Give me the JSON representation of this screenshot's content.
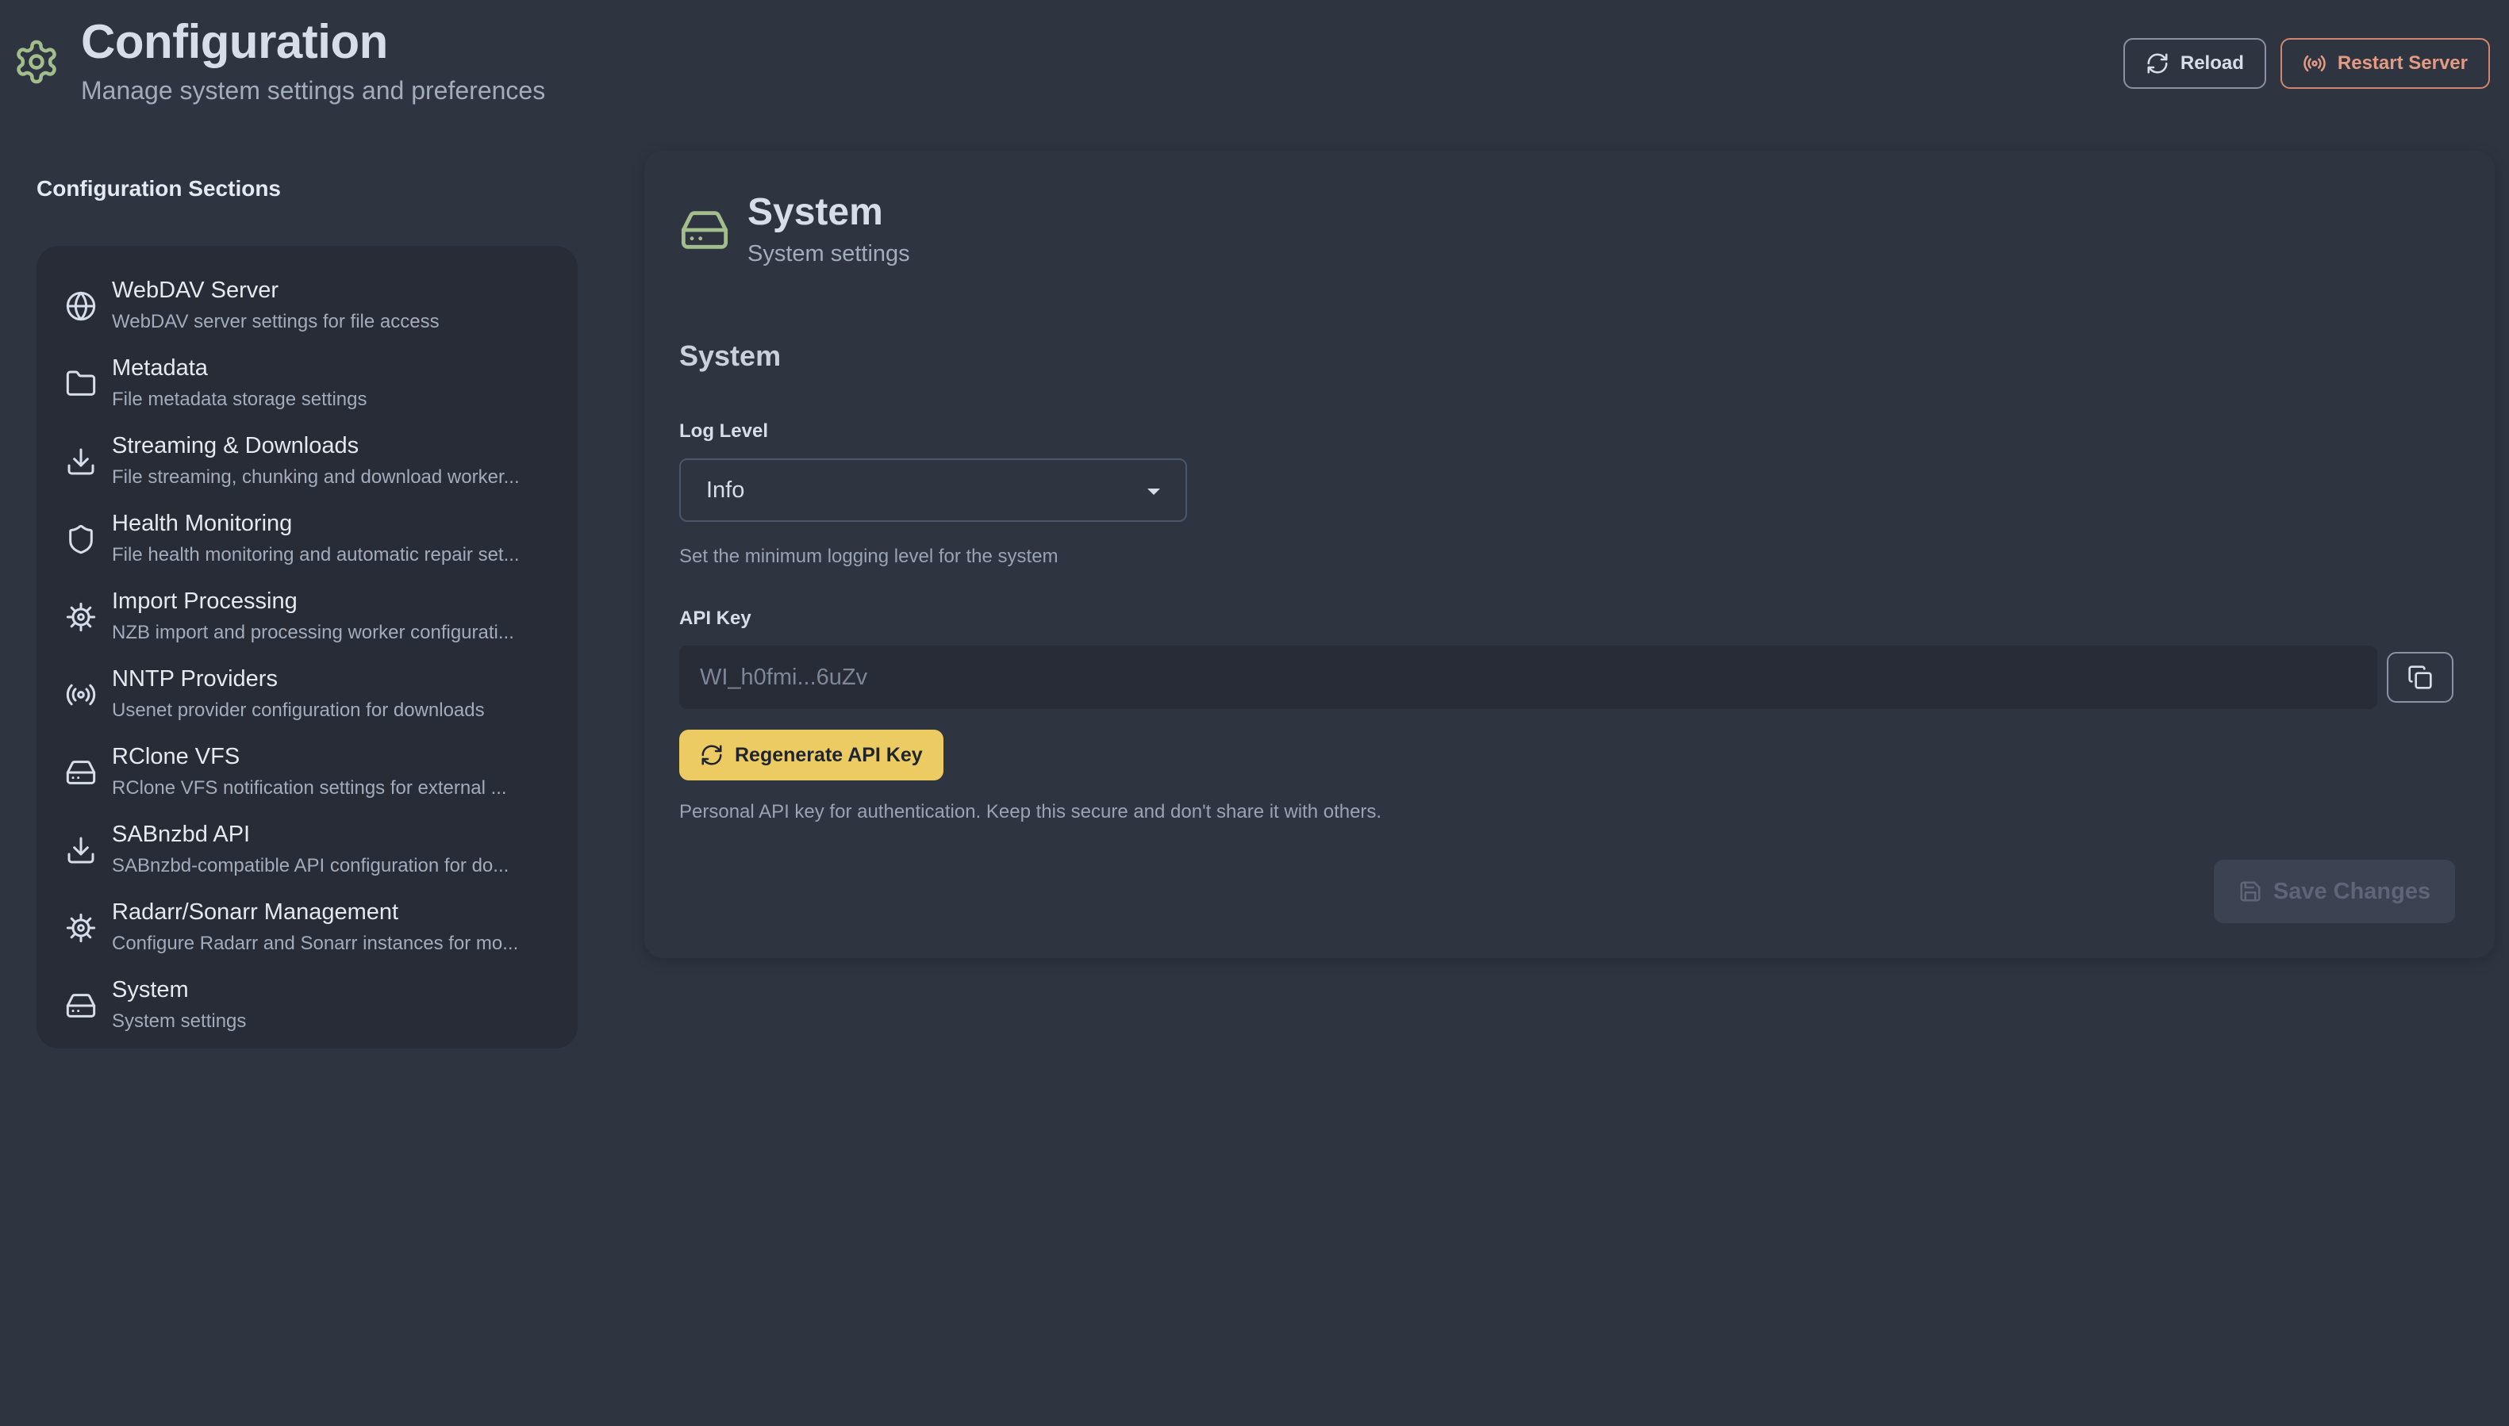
{
  "header": {
    "title": "Configuration",
    "subtitle": "Manage system settings and preferences",
    "icon": "gear-icon",
    "actions": {
      "reload_label": "Reload",
      "restart_label": "Restart Server"
    }
  },
  "sidebar": {
    "heading": "Configuration Sections",
    "items": [
      {
        "label": "WebDAV Server",
        "desc": "WebDAV server settings for file access",
        "icon": "globe-icon"
      },
      {
        "label": "Metadata",
        "desc": "File metadata storage settings",
        "icon": "folder-icon"
      },
      {
        "label": "Streaming & Downloads",
        "desc": "File streaming, chunking and download worker...",
        "icon": "download-icon"
      },
      {
        "label": "Health Monitoring",
        "desc": "File health monitoring and automatic repair set...",
        "icon": "shield-icon"
      },
      {
        "label": "Import Processing",
        "desc": "NZB import and processing worker configurati...",
        "icon": "cog-icon"
      },
      {
        "label": "NNTP Providers",
        "desc": "Usenet provider configuration for downloads",
        "icon": "broadcast-icon"
      },
      {
        "label": "RClone VFS",
        "desc": "RClone VFS notification settings for external ...",
        "icon": "hard-drive-icon"
      },
      {
        "label": "SABnzbd API",
        "desc": "SABnzbd-compatible API configuration for do...",
        "icon": "download-icon"
      },
      {
        "label": "Radarr/Sonarr Management",
        "desc": "Configure Radarr and Sonarr instances for mo...",
        "icon": "cog-icon"
      },
      {
        "label": "System",
        "desc": "System settings",
        "icon": "hard-drive-icon"
      }
    ]
  },
  "main": {
    "title": "System",
    "subtitle": "System settings",
    "icon": "hard-drive-icon",
    "group_title": "System",
    "log_level": {
      "label": "Log Level",
      "value": "Info",
      "help": "Set the minimum logging level for the system"
    },
    "api_key": {
      "label": "API Key",
      "value": "WI_h0fmi...6uZv",
      "regenerate_label": "Regenerate API Key",
      "help": "Personal API key for authentication. Keep this secure and don't share it with others."
    },
    "save_label": "Save Changes"
  },
  "colors": {
    "background": "#2e3440",
    "sidebar": "#272c36",
    "accent_green": "#a3be8c",
    "warning": "#d08770",
    "primary_button": "#ebcb62"
  }
}
